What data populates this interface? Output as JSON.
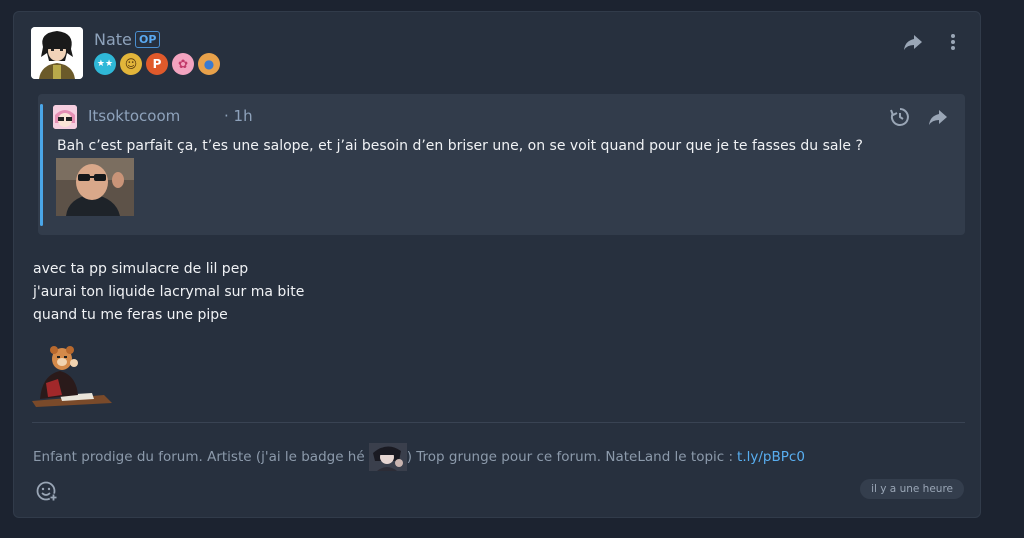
{
  "post": {
    "author": "Nate",
    "op_label": "OP",
    "badges": [
      {
        "name": "stars-badge",
        "color": "#2fb8d8",
        "glyph": "★★"
      },
      {
        "name": "emoji-badge",
        "color": "#e2b53a",
        "glyph": "☺"
      },
      {
        "name": "parking-badge",
        "color": "#e05a2b",
        "glyph": "P"
      },
      {
        "name": "anime-girl-badge",
        "color": "#f3a4c0",
        "glyph": "✿"
      },
      {
        "name": "palette-badge",
        "color": "#e8a14a",
        "glyph": "🎨"
      }
    ],
    "quote": {
      "author": "Itsoktocoom",
      "time": "· 1h",
      "text": "Bah c’est parfait ça, t’es une salope, et j’ai besoin d’en briser une, on se voit quand pour que je te fasses du sale ?"
    },
    "body_lines": [
      "avec ta pp simulacre de lil pep",
      "j'aurai ton liquide lacrymal sur ma bite",
      "quand tu me feras une pipe"
    ],
    "signature": {
      "before": "Enfant prodige du forum. Artiste (j'ai le badge hé",
      "after": ") Trop grunge pour ce forum. NateLand le topic :",
      "link": "t.ly/pBPc0"
    },
    "timestamp": "il y a une heure"
  },
  "colors": {
    "accent": "#4aa6e8",
    "background": "#1c2330",
    "card": "#27303e"
  }
}
